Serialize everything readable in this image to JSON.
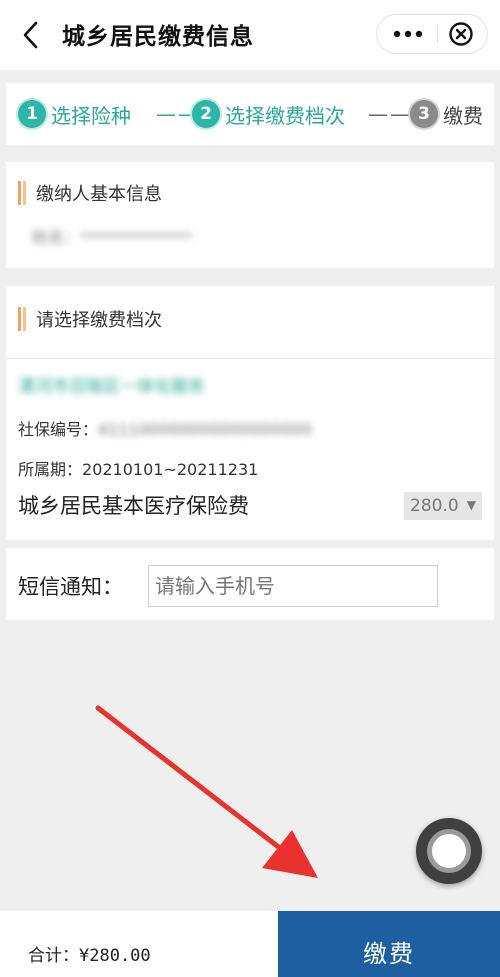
{
  "header": {
    "title": "城乡居民缴费信息",
    "back_icon": "chevron-left-icon",
    "more_icon": "more-dots-icon",
    "close_icon": "close-circle-icon"
  },
  "steps": [
    {
      "num": "1",
      "label": "选择险种",
      "state": "active"
    },
    {
      "num": "2",
      "label": "选择缴费档次",
      "state": "active"
    },
    {
      "num": "3",
      "label": "缴费",
      "state": "inactive"
    }
  ],
  "step_separator": "——",
  "payer_section": {
    "title": "缴纳人基本信息",
    "name_line": "姓名：**************"
  },
  "tier_section": {
    "title": "请选择缴费档次",
    "region": "漯河市召陵区一体化服务",
    "social_security_label": "社保编号：",
    "social_security_value": "411100000000000000000",
    "period_label": "所属期：",
    "period_value": "20210101~20211231",
    "insurance_name": "城乡居民基本医疗保险费",
    "tier_value": "280.0"
  },
  "sms": {
    "label": "短信通知：",
    "placeholder": "请输入手机号",
    "value": ""
  },
  "footer": {
    "total_label": "合计：",
    "total_value": "¥280.00",
    "pay_button": "缴费"
  },
  "colors": {
    "active_step": "#2aa998",
    "accent": "#f5a25b",
    "pay_button": "#1d5fa0",
    "annotation_arrow": "#e8322b"
  }
}
